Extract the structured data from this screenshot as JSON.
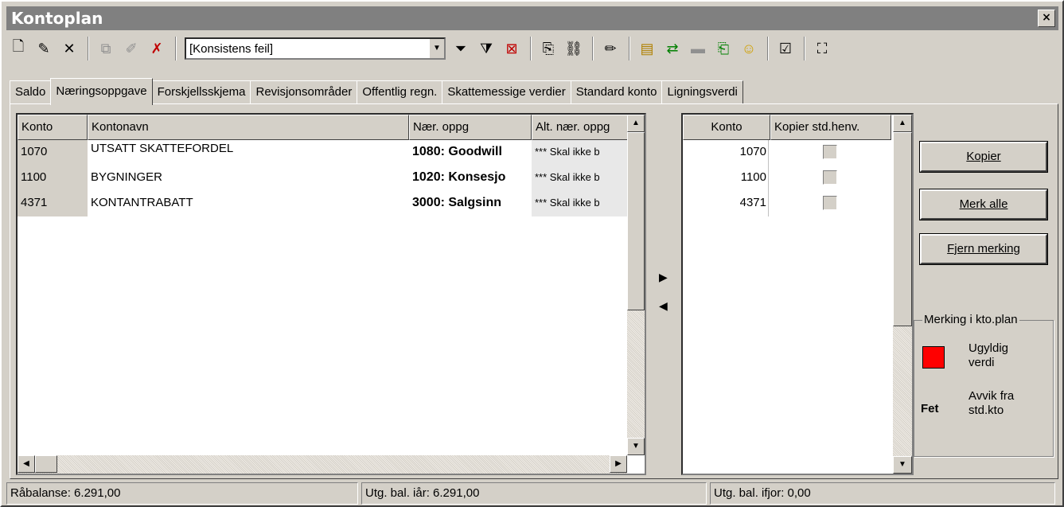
{
  "window": {
    "title": "Kontoplan",
    "close": "×"
  },
  "toolbar": {
    "filter_value": "[Konsistens feil]"
  },
  "tabs": [
    "Saldo",
    "Næringsoppgave",
    "Forskjellsskjema",
    "Revisjonsområder",
    "Offentlig regn.",
    "Skattemessige verdier",
    "Standard konto",
    "Ligningsverdi"
  ],
  "grid1": {
    "headers": [
      "Konto",
      "Kontonavn",
      "Nær. oppg",
      "Alt. nær. oppg"
    ],
    "rows": [
      {
        "konto": "1070",
        "navn": "UTSATT SKATTEFORDEL",
        "naer": "1080: Goodwill",
        "alt": "*** Skal ikke b"
      },
      {
        "konto": "1100",
        "navn": "BYGNINGER",
        "naer": "1020: Konsesjo",
        "alt": "*** Skal ikke b"
      },
      {
        "konto": "4371",
        "navn": "KONTANTRABATT",
        "naer": "3000: Salgsinn",
        "alt": "*** Skal ikke b"
      }
    ]
  },
  "grid2": {
    "headers": [
      "Konto",
      "Kopier std.henv."
    ],
    "rows": [
      "1070",
      "1100",
      "4371"
    ]
  },
  "buttons": {
    "kopier": "Kopier",
    "merk_alle": "Merk alle",
    "fjern": "Fjern merking"
  },
  "legend": {
    "title": "Merking i kto.plan",
    "invalid": "Ugyldig verdi",
    "invalid_l1": "Ugyldig",
    "invalid_l2": "verdi",
    "bold_label": "Fet",
    "deviation_l1": "Avvik fra",
    "deviation_l2": "std.kto",
    "red": "#ff0000"
  },
  "status": {
    "raabalanse": "Råbalanse: 6.291,00",
    "utg_iaar": "Utg. bal. iår: 6.291,00",
    "utg_ifjor": "Utg. bal. ifjor: 0,00"
  }
}
